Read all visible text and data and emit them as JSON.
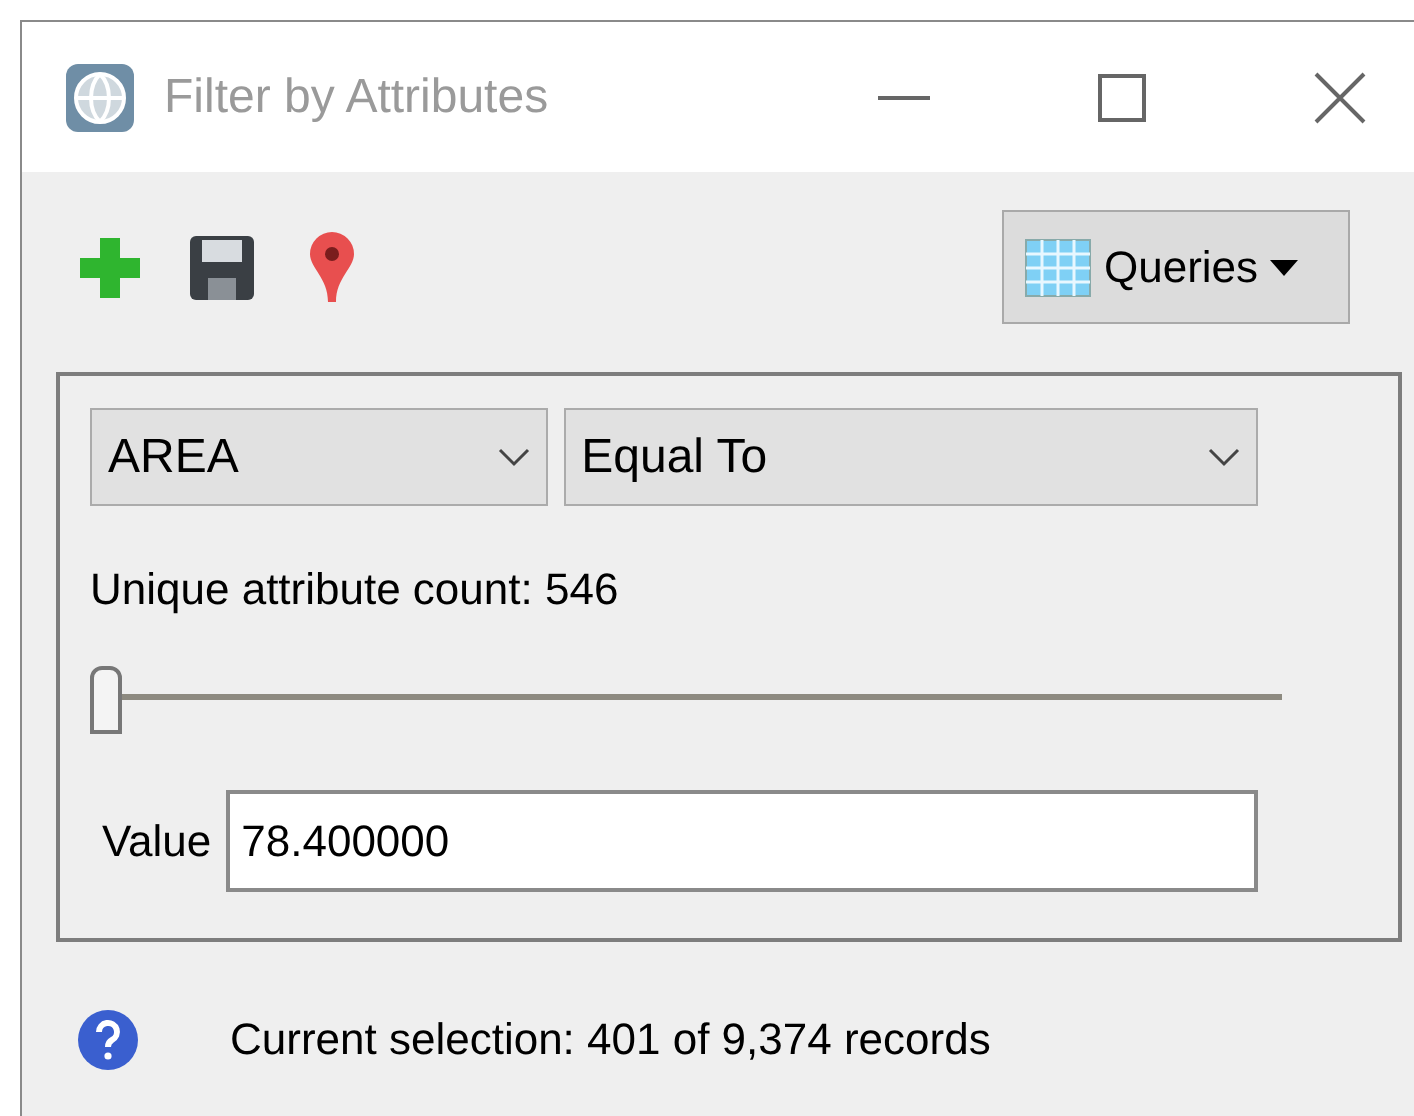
{
  "window": {
    "title": "Filter by Attributes"
  },
  "toolbar": {
    "queries_button": "Queries"
  },
  "field_dropdown": {
    "value": "AREA"
  },
  "operator_dropdown": {
    "value": "Equal To"
  },
  "unique_count_label": "Unique attribute count: 546",
  "slider": {
    "level": 0
  },
  "value_field": {
    "label": "Value",
    "value": "78.400000"
  },
  "status": "Current selection: 401 of 9,374 records"
}
